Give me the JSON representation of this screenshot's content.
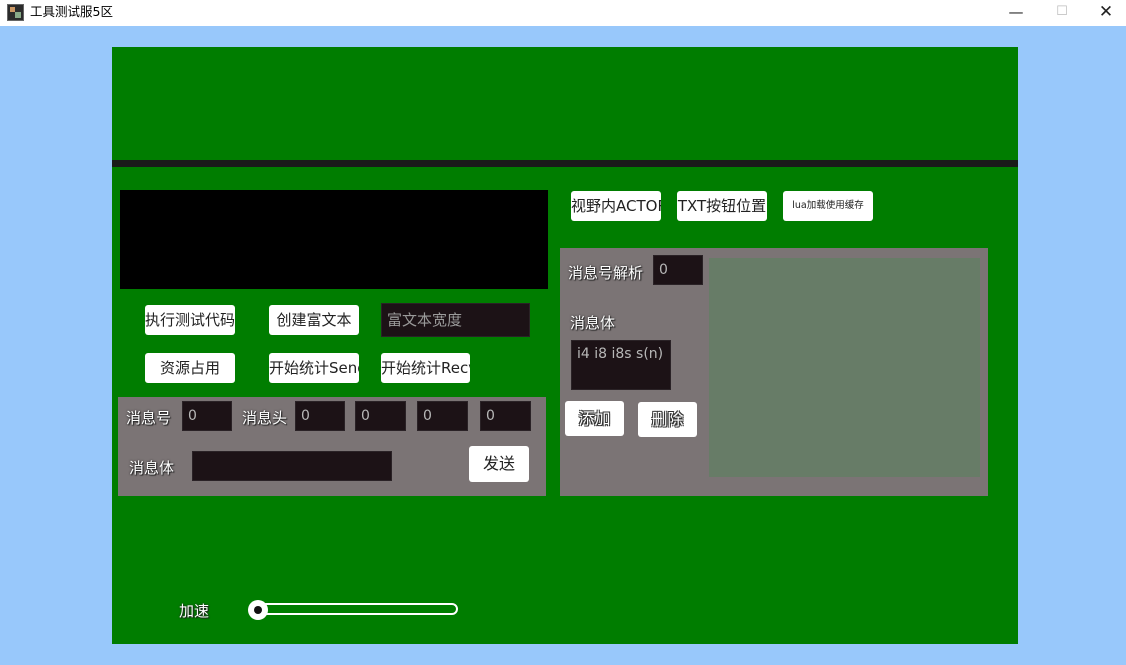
{
  "window": {
    "title": "工具测试服5区",
    "minimize": "—",
    "maximize": "☐",
    "close": "✕"
  },
  "toolbar": {
    "view_actor": "视野内ACTOR",
    "txt_button_pos": "TXT按钮位置",
    "lua_cache": "lua加载使用缓存"
  },
  "left": {
    "run_test_code": "执行测试代码",
    "create_rich_text": "创建富文本",
    "rich_text_width_placeholder": "富文本宽度",
    "resource_usage": "资源占用",
    "start_stat_send": "开始统计Send",
    "start_stat_recv": "开始统计Recv"
  },
  "send_panel": {
    "msg_id_label": "消息号",
    "msg_id_value": "0",
    "msg_head_label": "消息头",
    "head_values": [
      "0",
      "0",
      "0",
      "0"
    ],
    "msg_body_label": "消息体",
    "msg_body_value": "",
    "send_button": "发送"
  },
  "parse_panel": {
    "parse_label": "消息号解析",
    "parse_value": "0",
    "body_label": "消息体",
    "body_value": "i4 i8 i8s s(n)",
    "add_button": "添加",
    "delete_button": "删除"
  },
  "speed": {
    "label": "加速",
    "value": 0
  }
}
